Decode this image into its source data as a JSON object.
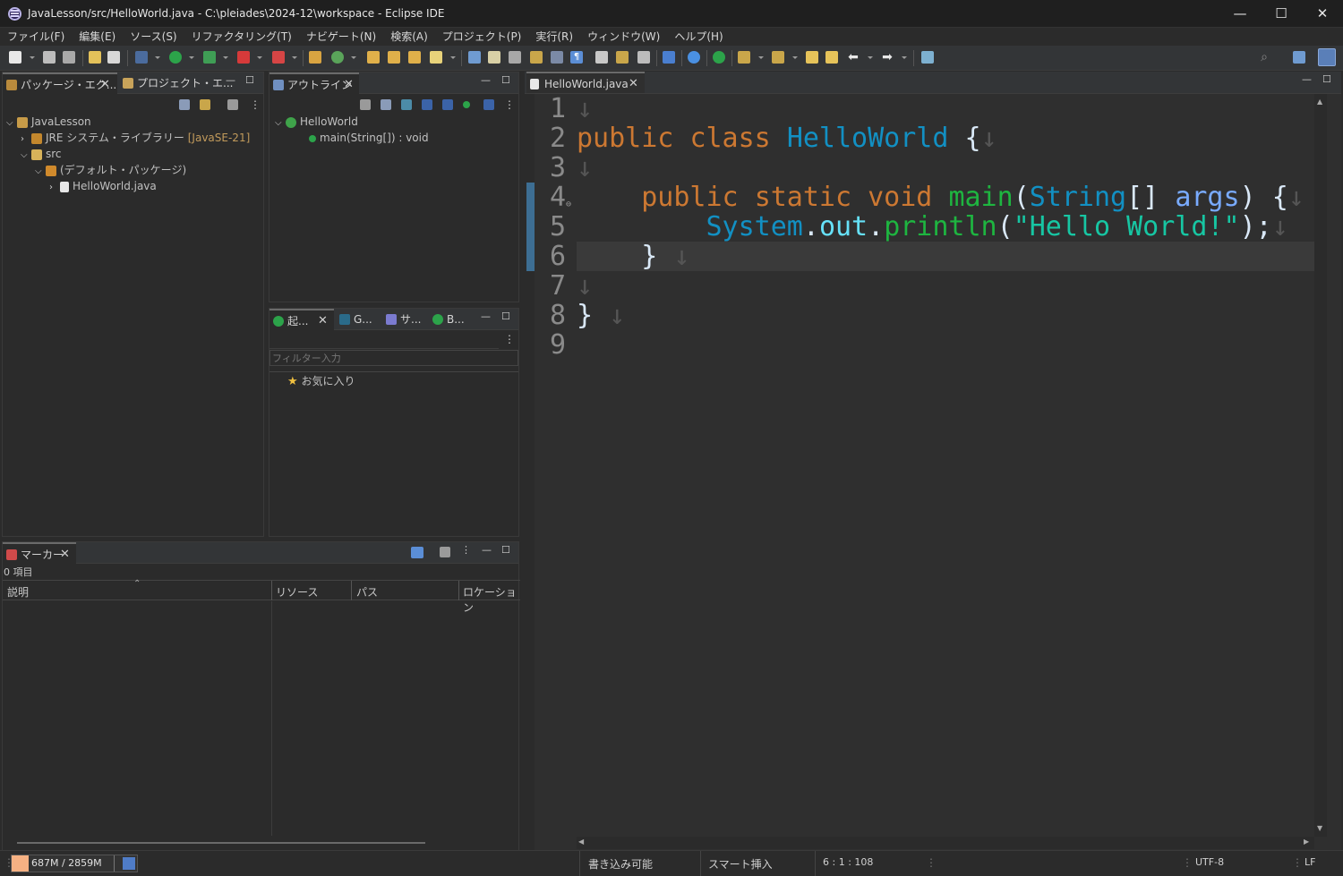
{
  "window": {
    "title": "JavaLesson/src/HelloWorld.java - C:\\pleiades\\2024-12\\workspace - Eclipse IDE",
    "minimize": "—",
    "maximize": "☐",
    "close": "✕"
  },
  "menu": [
    "ファイル(F)",
    "編集(E)",
    "ソース(S)",
    "リファクタリング(T)",
    "ナビゲート(N)",
    "検索(A)",
    "プロジェクト(P)",
    "実行(R)",
    "ウィンドウ(W)",
    "ヘルプ(H)"
  ],
  "explorer": {
    "tabs": [
      {
        "label": "パッケージ・エク...",
        "icon": "package-explorer-icon"
      },
      {
        "label": "プロジェクト・エ...",
        "icon": "project-explorer-icon"
      }
    ],
    "tree": [
      {
        "label": "JavaLesson",
        "icon": "java-project-icon",
        "expanded": true
      },
      {
        "label": "JRE システム・ライブラリー",
        "suffix": "[JavaSE-21]",
        "icon": "library-icon",
        "expanded": false
      },
      {
        "label": "src",
        "icon": "source-folder-icon",
        "expanded": true
      },
      {
        "label": "(デフォルト・パッケージ)",
        "icon": "package-icon",
        "expanded": true
      },
      {
        "label": "HelloWorld.java",
        "icon": "java-file-icon",
        "expanded": false
      }
    ]
  },
  "outline": {
    "tab": "アウトライン",
    "items": [
      {
        "label": "HelloWorld",
        "icon": "class-icon"
      },
      {
        "label": "main(String[]) : void",
        "icon": "method-icon"
      }
    ]
  },
  "launch": {
    "tabs": [
      "起...",
      "G...",
      "サ...",
      "B..."
    ],
    "filter_placeholder": "フィルター入力",
    "favorites": "お気に入り"
  },
  "markers": {
    "tab": "マーカー",
    "count": "0 項目",
    "columns": [
      "説明",
      "リソース",
      "パス",
      "ロケーション"
    ]
  },
  "editor": {
    "tab": "HelloWorld.java",
    "lines": [
      "1",
      "2",
      "3",
      "4",
      "5",
      "6",
      "7",
      "8",
      "9"
    ],
    "code": {
      "l2": [
        "public",
        "class",
        "HelloWorld",
        "{"
      ],
      "l4": [
        "public",
        "static",
        "void",
        "main",
        "(",
        "String",
        "[]",
        "args",
        ")",
        "{"
      ],
      "l5": [
        "System",
        ".",
        "out",
        ".",
        "println",
        "(",
        "\"Hello World!\"",
        ")",
        ";"
      ],
      "l6": [
        "}"
      ],
      "l8": [
        "}"
      ]
    },
    "whitespace_glyph": "↓"
  },
  "status": {
    "memory": "687M / 2859M",
    "writable": "書き込み可能",
    "insert_mode": "スマート挿入",
    "position": "6 : 1 : 108",
    "encoding": "UTF-8",
    "line_ending": "LF"
  },
  "colors": {
    "keyword": "#cc7832",
    "class": "#1290c3",
    "method": "#1eb540",
    "field": "#66e1f8",
    "string": "#17c6a3",
    "param": "#79abff"
  }
}
